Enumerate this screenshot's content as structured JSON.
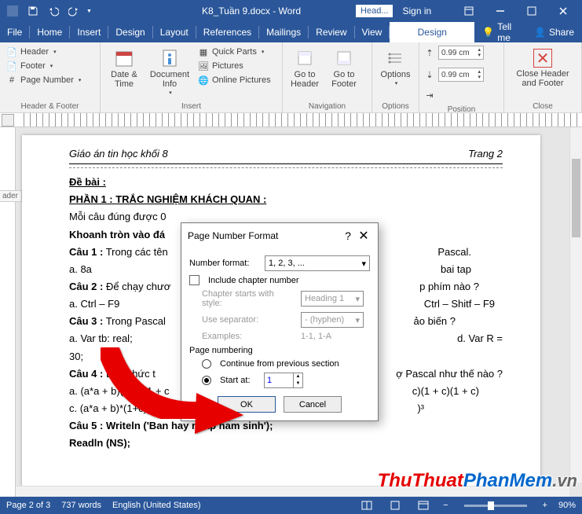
{
  "titlebar": {
    "doc_title": "K8_Tuần 9.docx - Word",
    "context_tab": "Head...",
    "sign_in": "Sign in"
  },
  "tabs": {
    "file": "File",
    "home": "Home",
    "insert": "Insert",
    "design": "Design",
    "layout": "Layout",
    "references": "References",
    "mailings": "Mailings",
    "review": "Review",
    "view": "View",
    "hf_design": "Design",
    "tell_me": "Tell me",
    "share": "Share"
  },
  "ribbon": {
    "hf": {
      "header": "Header",
      "footer": "Footer",
      "page_number": "Page Number",
      "group": "Header & Footer"
    },
    "insert": {
      "date_time": "Date & Time",
      "doc_info": "Document Info",
      "quick_parts": "Quick Parts",
      "pictures": "Pictures",
      "online_pictures": "Online Pictures",
      "group": "Insert"
    },
    "nav": {
      "goto_header": "Go to Header",
      "goto_footer": "Go to Footer",
      "group": "Navigation"
    },
    "options": {
      "label": "Options",
      "group": "Options"
    },
    "position": {
      "top": "0.99 cm",
      "bottom": "0.99 cm",
      "group": "Position"
    },
    "close": {
      "label": "Close Header and Footer",
      "group": "Close"
    }
  },
  "document": {
    "header_left": "Giáo án tin học khối 8",
    "header_right": "Trang 2",
    "header_tag": "ader",
    "line1": "Đề bài :",
    "line2": "PHẦN 1 : TRẮC NGHIỆM KHÁCH QUAN :",
    "line3": "Mỗi câu đúng được 0",
    "line4": "Khoanh tròn vào đá",
    "line5a": "Câu 1 :",
    "line5b": " Trong các tên",
    "line5_end": "Pascal.",
    "line6": "a. 8a",
    "line6_end": "bai tap",
    "line7a": "Câu 2 :",
    "line7b": " Để chạy chươ",
    "line7_end": "p phím nào  ?",
    "line8": "a. Ctrl – F9",
    "line8_end": "Ctrl – Shitf – F9",
    "line9a": "Câu 3 :",
    "line9b": "  Trong Pascal",
    "line9_end": "ảo biến ?",
    "line10": "a. Var  tb: real;",
    "line10_end": "d. Var R =",
    "line11": "30;",
    "line12a": "Câu 4 :",
    "line12b": " Biểu thức t",
    "line12_end": "ợ Pascal như thế nào ?",
    "line13": "a. (a*a + b)(1+c)(1 + c",
    "line13_end": "c)(1 + c)(1 + c)",
    "line14": "c. (a*a + b)*(1+c)*(1 + c)",
    "line14_end": ")³",
    "line15a": "Câu 5 :",
    "line15b": "       Writeln ('Ban hay nhap nam sinh');",
    "line16": "                   Readln (NS);"
  },
  "dialog": {
    "title": "Page Number Format",
    "numfmt_label": "Number format:",
    "numfmt_value": "1, 2, 3, ...",
    "include_chapter": "Include chapter number",
    "chapter_style_label": "Chapter starts with style:",
    "chapter_style_value": "Heading 1",
    "separator_label": "Use separator:",
    "separator_value": "-  (hyphen)",
    "examples_label": "Examples:",
    "examples_value": "1-1, 1-A",
    "numbering_label": "Page numbering",
    "continue": "Continue from previous section",
    "start_at": "Start at:",
    "start_at_value": "1",
    "ok": "OK",
    "cancel": "Cancel"
  },
  "statusbar": {
    "page": "Page 2 of 3",
    "words": "737 words",
    "lang": "English (United States)",
    "zoom": "90%"
  },
  "watermark": {
    "a": "ThuThuat",
    "b": "PhanMem",
    "c": ".vn"
  }
}
